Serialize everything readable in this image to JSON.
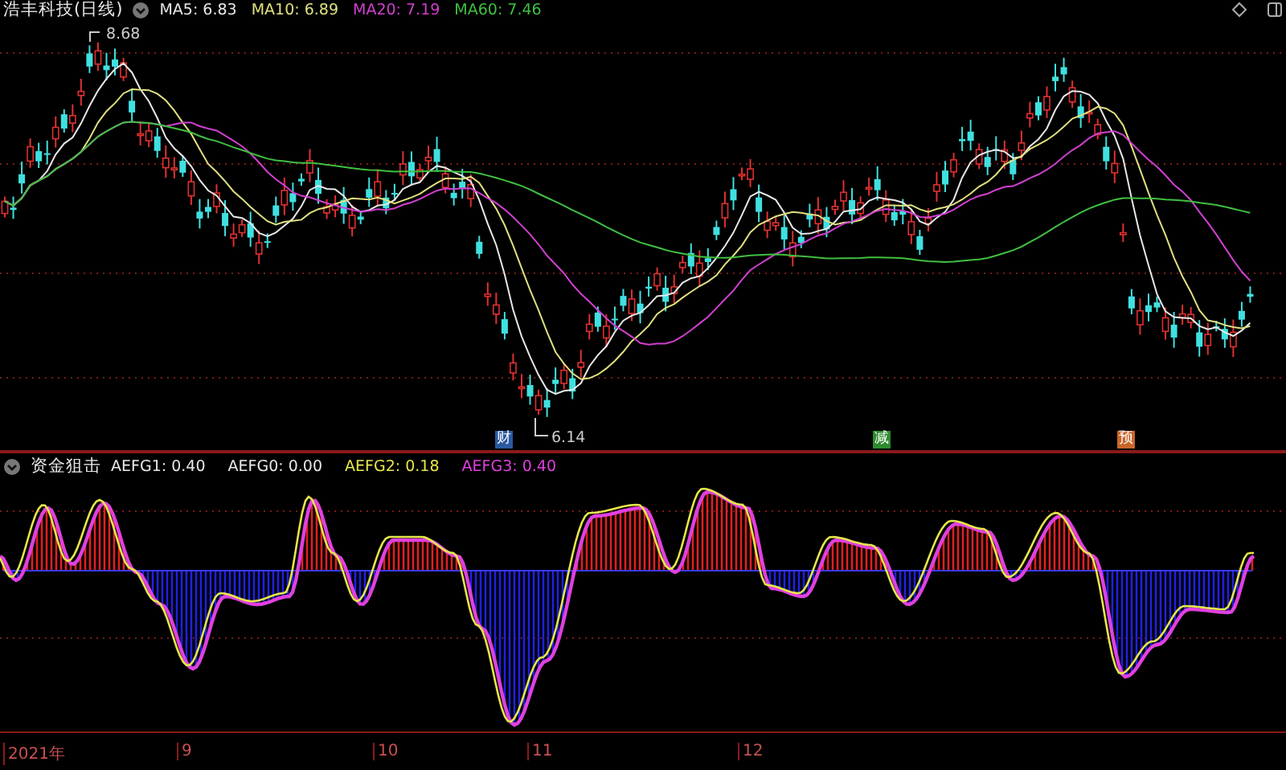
{
  "header": {
    "title": "浩丰科技(日线)",
    "indicators": [
      {
        "label": "MA5: 6.83",
        "color": "#e8e8e8"
      },
      {
        "label": "MA10: 6.89",
        "color": "#e0e080"
      },
      {
        "label": "MA20: 7.19",
        "color": "#d040d0"
      },
      {
        "label": "MA60: 7.46",
        "color": "#40c040"
      }
    ]
  },
  "price_chart": {
    "high_label": "8.68",
    "low_label": "6.14",
    "event_badges": [
      {
        "label": "财",
        "color": "#2a5aa0"
      },
      {
        "label": "减",
        "color": "#2e8b2e"
      },
      {
        "label": "预",
        "color": "#c8662a"
      }
    ]
  },
  "indicator_panel": {
    "title": "资金狙击",
    "values": [
      {
        "label": "AEFG1: 0.40",
        "color": "#e8e8e8"
      },
      {
        "label": "AEFG0: 0.00",
        "color": "#e8e8e8"
      },
      {
        "label": "AEFG2: 0.18",
        "color": "#e6e64a"
      },
      {
        "label": "AEFG3: 0.40",
        "color": "#e040e0"
      }
    ]
  },
  "time_axis": {
    "labels": [
      "2021年",
      "9",
      "10",
      "11",
      "12"
    ]
  }
}
